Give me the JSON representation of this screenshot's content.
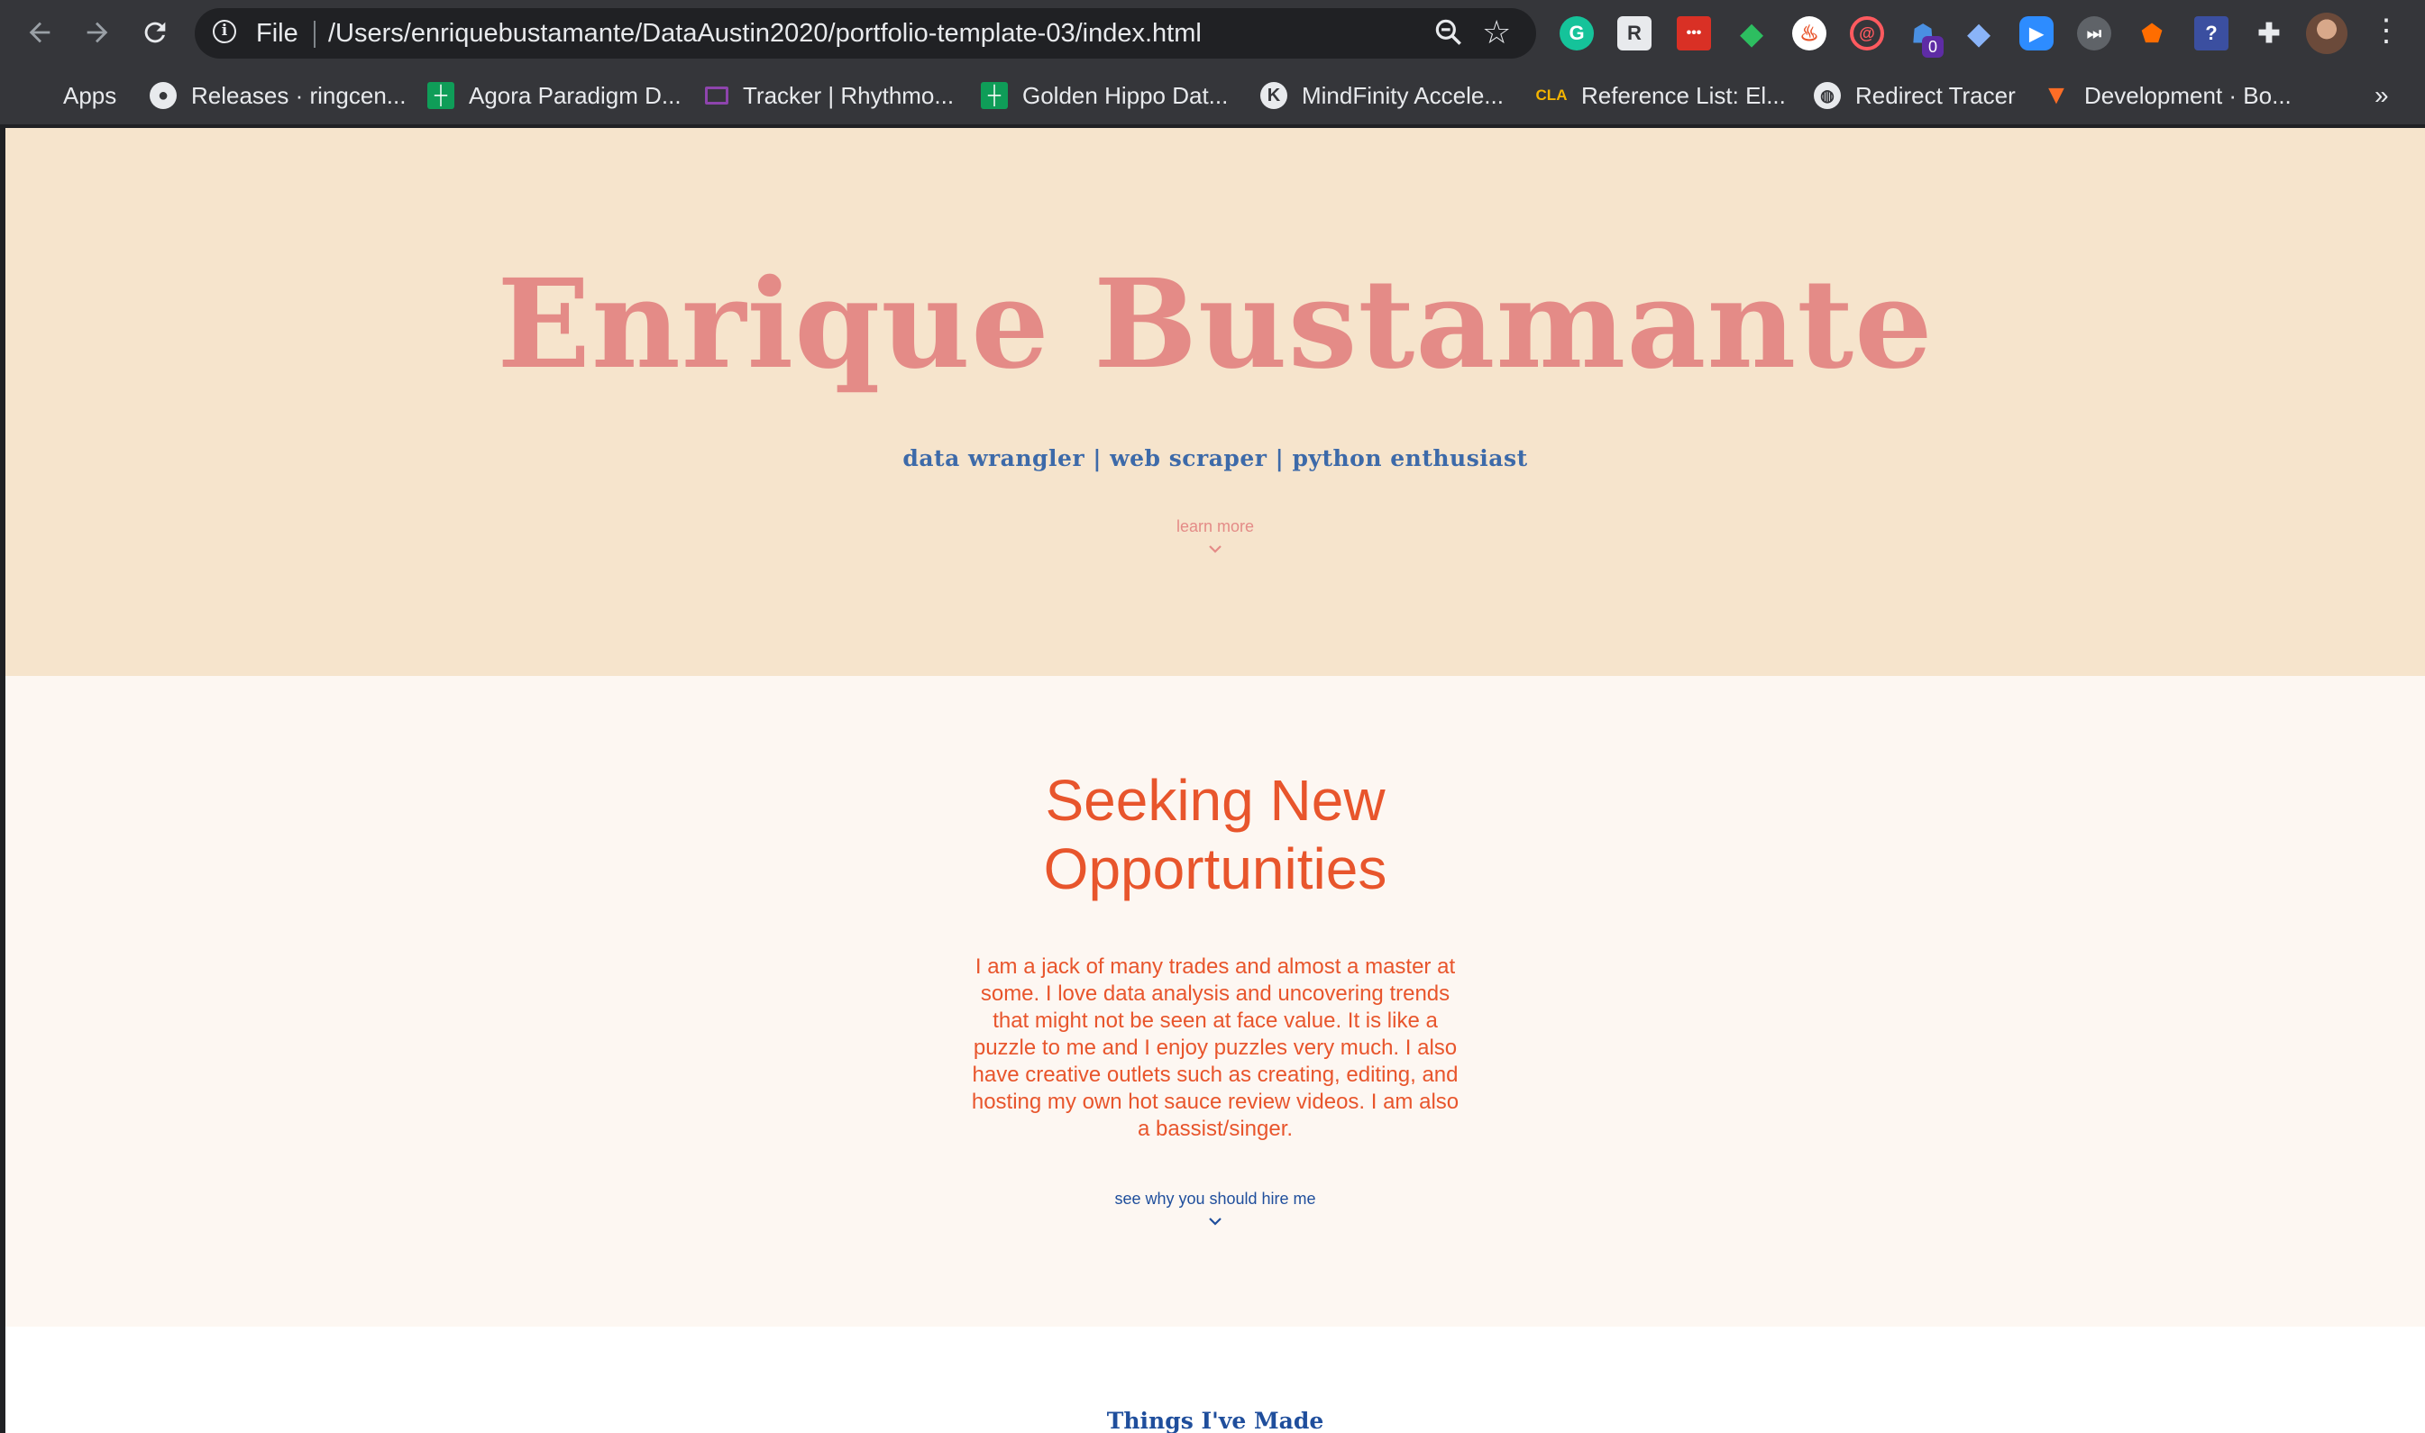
{
  "browser": {
    "nav": {
      "back_icon": "arrow-left-icon",
      "forward_icon": "arrow-right-icon",
      "reload_icon": "reload-icon"
    },
    "omnibox": {
      "scheme_label": "File",
      "url": "/Users/enriquebustamante/DataAustin2020/portfolio-template-03/index.html"
    },
    "extension_badge": "0",
    "bookmarks": [
      {
        "label": "Apps",
        "icon": "apps-grid-icon"
      },
      {
        "label": "Releases · ringcen...",
        "icon": "github-icon"
      },
      {
        "label": "Agora Paradigm D...",
        "icon": "sheets-icon"
      },
      {
        "label": "Tracker | Rhythmo...",
        "icon": "tracker-icon"
      },
      {
        "label": "Golden Hippo Dat...",
        "icon": "sheets-icon"
      },
      {
        "label": "MindFinity Accele...",
        "icon": "k-icon"
      },
      {
        "label": "Reference List: El...",
        "icon": "cla-icon"
      },
      {
        "label": "Redirect Tracer",
        "icon": "globe-icon"
      },
      {
        "label": "Development · Bo...",
        "icon": "gitlab-icon"
      }
    ],
    "bookmarks_more": "»"
  },
  "hero": {
    "title": "Enrique Bustamante",
    "subtitle": "data wrangler | web scraper | python enthusiast",
    "link": "learn more"
  },
  "about": {
    "title_line1": "Seeking New",
    "title_line2": "Opportunities",
    "body": "I am a jack of many trades and almost a master at some. I love data analysis and uncovering trends that might not be seen at face value. It is like a puzzle to me and I enjoy puzzles very much. I also have creative outlets such as creating, editing, and hosting my own hot sauce review videos. I am also a bassist/singer.",
    "link": "see why you should hire me"
  },
  "projects": {
    "title": "Things I've Made"
  },
  "colors": {
    "hero_bg": "#f6e4cc",
    "hero_accent": "#e48b87",
    "about_bg": "#fdf7f2",
    "about_accent": "#e8552c",
    "link_blue": "#1f4e9c"
  }
}
